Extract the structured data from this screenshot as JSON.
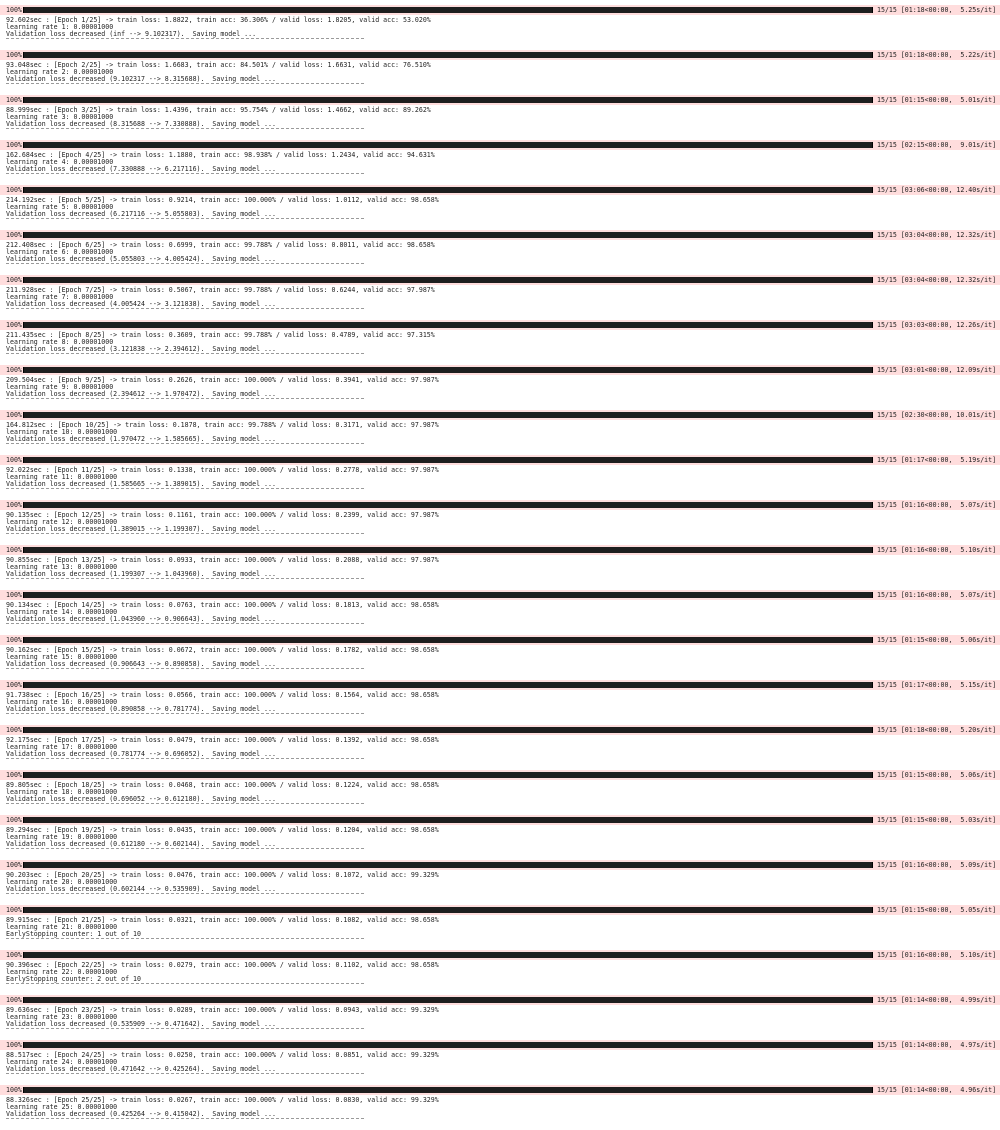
{
  "log": {
    "epochs": [
      {
        "pct": "100%",
        "tail": "15/15 [01:18<00:00,  5.25s/it]",
        "summary": "92.602sec : [Epoch 1/25] -> train loss: 1.8822, train acc: 36.306% / valid loss: 1.8205, valid acc: 53.020%",
        "lr": "learning rate 1: 0.00001000",
        "status": "Validation loss decreased (inf --> 9.102317).  Saving model ..."
      },
      {
        "pct": "100%",
        "tail": "15/15 [01:18<00:00,  5.22s/it]",
        "summary": "93.048sec : [Epoch 2/25] -> train loss: 1.6683, train acc: 84.501% / valid loss: 1.6631, valid acc: 76.510%",
        "lr": "learning rate 2: 0.00001000",
        "status": "Validation loss decreased (9.102317 --> 8.315688).  Saving model ..."
      },
      {
        "pct": "100%",
        "tail": "15/15 [01:15<00:00,  5.01s/it]",
        "summary": "88.999sec : [Epoch 3/25] -> train loss: 1.4396, train acc: 95.754% / valid loss: 1.4662, valid acc: 89.262%",
        "lr": "learning rate 3: 0.00001000",
        "status": "Validation loss decreased (8.315688 --> 7.330888).  Saving model ..."
      },
      {
        "pct": "100%",
        "tail": "15/15 [02:15<00:00,  9.01s/it]",
        "summary": "162.684sec : [Epoch 4/25] -> train loss: 1.1880, train acc: 98.938% / valid loss: 1.2434, valid acc: 94.631%",
        "lr": "learning rate 4: 0.00001000",
        "status": "Validation loss decreased (7.330888 --> 6.217116).  Saving model ..."
      },
      {
        "pct": "100%",
        "tail": "15/15 [03:06<00:00, 12.40s/it]",
        "summary": "214.192sec : [Epoch 5/25] -> train loss: 0.9214, train acc: 100.000% / valid loss: 1.0112, valid acc: 98.658%",
        "lr": "learning rate 5: 0.00001000",
        "status": "Validation loss decreased (6.217116 --> 5.055803).  Saving model ..."
      },
      {
        "pct": "100%",
        "tail": "15/15 [03:04<00:00, 12.32s/it]",
        "summary": "212.408sec : [Epoch 6/25] -> train loss: 0.6999, train acc: 99.788% / valid loss: 0.8011, valid acc: 98.658%",
        "lr": "learning rate 6: 0.00001000",
        "status": "Validation loss decreased (5.055803 --> 4.005424).  Saving model ..."
      },
      {
        "pct": "100%",
        "tail": "15/15 [03:04<00:00, 12.32s/it]",
        "summary": "211.928sec : [Epoch 7/25] -> train loss: 0.5067, train acc: 99.788% / valid loss: 0.6244, valid acc: 97.987%",
        "lr": "learning rate 7: 0.00001000",
        "status": "Validation loss decreased (4.005424 --> 3.121838).  Saving model ..."
      },
      {
        "pct": "100%",
        "tail": "15/15 [03:03<00:00, 12.26s/it]",
        "summary": "211.435sec : [Epoch 8/25] -> train loss: 0.3609, train acc: 99.788% / valid loss: 0.4789, valid acc: 97.315%",
        "lr": "learning rate 8: 0.00001000",
        "status": "Validation loss decreased (3.121838 --> 2.394612).  Saving model ..."
      },
      {
        "pct": "100%",
        "tail": "15/15 [03:01<00:00, 12.09s/it]",
        "summary": "209.504sec : [Epoch 9/25] -> train loss: 0.2626, train acc: 100.000% / valid loss: 0.3941, valid acc: 97.987%",
        "lr": "learning rate 9: 0.00001000",
        "status": "Validation loss decreased (2.394612 --> 1.970472).  Saving model ..."
      },
      {
        "pct": "100%",
        "tail": "15/15 [02:30<00:00, 10.01s/it]",
        "summary": "164.812sec : [Epoch 10/25] -> train loss: 0.1878, train acc: 99.788% / valid loss: 0.3171, valid acc: 97.987%",
        "lr": "learning rate 10: 0.00001000",
        "status": "Validation loss decreased (1.970472 --> 1.585665).  Saving model ..."
      },
      {
        "pct": "100%",
        "tail": "15/15 [01:17<00:00,  5.19s/it]",
        "summary": "92.022sec : [Epoch 11/25] -> train loss: 0.1338, train acc: 100.000% / valid loss: 0.2778, valid acc: 97.987%",
        "lr": "learning rate 11: 0.00001000",
        "status": "Validation loss decreased (1.585665 --> 1.389015).  Saving model ..."
      },
      {
        "pct": "100%",
        "tail": "15/15 [01:16<00:00,  5.07s/it]",
        "summary": "90.135sec : [Epoch 12/25] -> train loss: 0.1161, train acc: 100.000% / valid loss: 0.2399, valid acc: 97.987%",
        "lr": "learning rate 12: 0.00001000",
        "status": "Validation loss decreased (1.389015 --> 1.199307).  Saving model ..."
      },
      {
        "pct": "100%",
        "tail": "15/15 [01:16<00:00,  5.10s/it]",
        "summary": "90.855sec : [Epoch 13/25] -> train loss: 0.0933, train acc: 100.000% / valid loss: 0.2088, valid acc: 97.987%",
        "lr": "learning rate 13: 0.00001000",
        "status": "Validation loss decreased (1.199307 --> 1.043960).  Saving model ..."
      },
      {
        "pct": "100%",
        "tail": "15/15 [01:16<00:00,  5.07s/it]",
        "summary": "90.134sec : [Epoch 14/25] -> train loss: 0.0763, train acc: 100.000% / valid loss: 0.1813, valid acc: 98.658%",
        "lr": "learning rate 14: 0.00001000",
        "status": "Validation loss decreased (1.043960 --> 0.906643).  Saving model ..."
      },
      {
        "pct": "100%",
        "tail": "15/15 [01:15<00:00,  5.06s/it]",
        "summary": "90.162sec : [Epoch 15/25] -> train loss: 0.0672, train acc: 100.000% / valid loss: 0.1782, valid acc: 98.658%",
        "lr": "learning rate 15: 0.00001000",
        "status": "Validation loss decreased (0.906643 --> 0.890858).  Saving model ..."
      },
      {
        "pct": "100%",
        "tail": "15/15 [01:17<00:00,  5.15s/it]",
        "summary": "91.738sec : [Epoch 16/25] -> train loss: 0.0566, train acc: 100.000% / valid loss: 0.1564, valid acc: 98.658%",
        "lr": "learning rate 16: 0.00001000",
        "status": "Validation loss decreased (0.890858 --> 0.781774).  Saving model ..."
      },
      {
        "pct": "100%",
        "tail": "15/15 [01:18<00:00,  5.20s/it]",
        "summary": "92.175sec : [Epoch 17/25] -> train loss: 0.0479, train acc: 100.000% / valid loss: 0.1392, valid acc: 98.658%",
        "lr": "learning rate 17: 0.00001000",
        "status": "Validation loss decreased (0.781774 --> 0.696052).  Saving model ..."
      },
      {
        "pct": "100%",
        "tail": "15/15 [01:15<00:00,  5.06s/it]",
        "summary": "89.805sec : [Epoch 18/25] -> train loss: 0.0468, train acc: 100.000% / valid loss: 0.1224, valid acc: 98.658%",
        "lr": "learning rate 18: 0.00001000",
        "status": "Validation loss decreased (0.696052 --> 0.612180).  Saving model ..."
      },
      {
        "pct": "100%",
        "tail": "15/15 [01:15<00:00,  5.03s/it]",
        "summary": "89.294sec : [Epoch 19/25] -> train loss: 0.0435, train acc: 100.000% / valid loss: 0.1204, valid acc: 98.658%",
        "lr": "learning rate 19: 0.00001000",
        "status": "Validation loss decreased (0.612180 --> 0.602144).  Saving model ..."
      },
      {
        "pct": "100%",
        "tail": "15/15 [01:16<00:00,  5.09s/it]",
        "summary": "90.203sec : [Epoch 20/25] -> train loss: 0.0476, train acc: 100.000% / valid loss: 0.1072, valid acc: 99.329%",
        "lr": "learning rate 20: 0.00001000",
        "status": "Validation loss decreased (0.602144 --> 0.535909).  Saving model ..."
      },
      {
        "pct": "100%",
        "tail": "15/15 [01:15<00:00,  5.05s/it]",
        "summary": "89.915sec : [Epoch 21/25] -> train loss: 0.0321, train acc: 100.000% / valid loss: 0.1082, valid acc: 98.658%",
        "lr": "learning rate 21: 0.00001000",
        "status": "EarlyStopping counter: 1 out of 10"
      },
      {
        "pct": "100%",
        "tail": "15/15 [01:16<00:00,  5.10s/it]",
        "summary": "90.396sec : [Epoch 22/25] -> train loss: 0.0279, train acc: 100.000% / valid loss: 0.1102, valid acc: 98.658%",
        "lr": "learning rate 22: 0.00001000",
        "status": "EarlyStopping counter: 2 out of 10"
      },
      {
        "pct": "100%",
        "tail": "15/15 [01:14<00:00,  4.99s/it]",
        "summary": "89.636sec : [Epoch 23/25] -> train loss: 0.0289, train acc: 100.000% / valid loss: 0.0943, valid acc: 99.329%",
        "lr": "learning rate 23: 0.00001000",
        "status": "Validation loss decreased (0.535909 --> 0.471642).  Saving model ..."
      },
      {
        "pct": "100%",
        "tail": "15/15 [01:14<00:00,  4.97s/it]",
        "summary": "88.517sec : [Epoch 24/25] -> train loss: 0.0250, train acc: 100.000% / valid loss: 0.0851, valid acc: 99.329%",
        "lr": "learning rate 24: 0.00001000",
        "status": "Validation loss decreased (0.471642 --> 0.425264).  Saving model ..."
      },
      {
        "pct": "100%",
        "tail": "15/15 [01:14<00:00,  4.96s/it]",
        "summary": "88.326sec : [Epoch 25/25] -> train loss: 0.0267, train acc: 100.000% / valid loss: 0.0830, valid acc: 99.329%",
        "lr": "learning rate 25: 0.00001000",
        "status": "Validation loss decreased (0.425264 --> 0.415042).  Saving model ..."
      }
    ]
  }
}
